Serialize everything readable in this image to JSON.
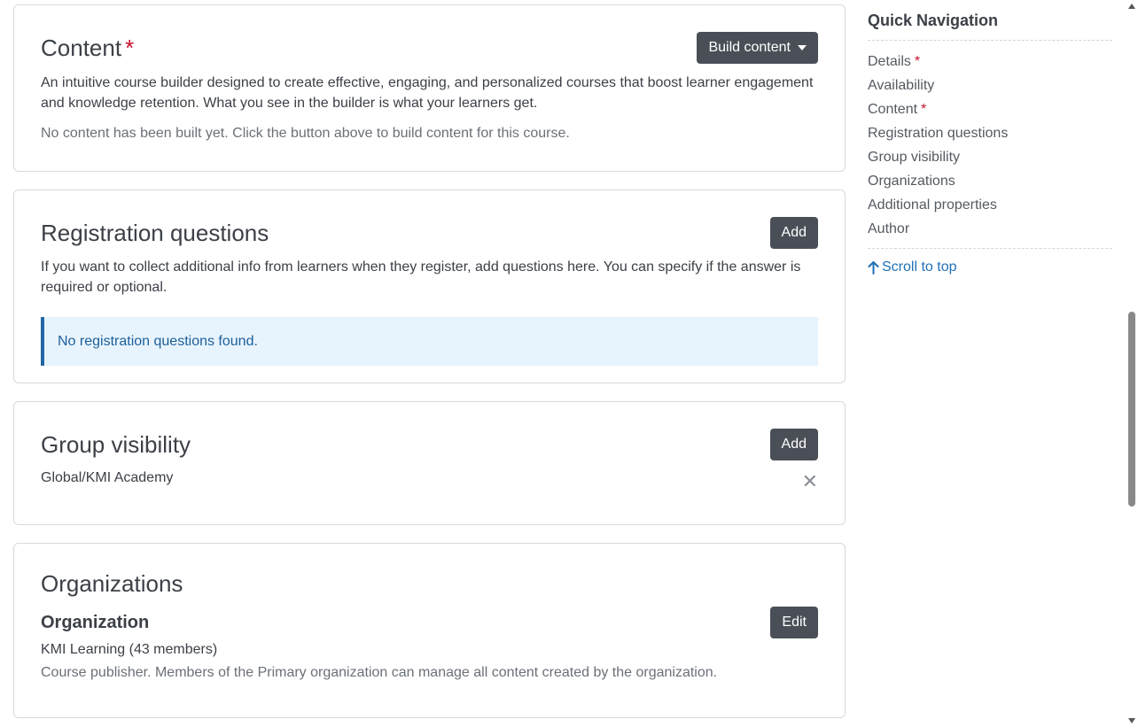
{
  "content": {
    "title": "Content",
    "required_mark": "*",
    "build_button": "Build content",
    "description": "An intuitive course builder designed to create effective, engaging, and personalized courses that boost learner engagement and knowledge retention. What you see in the builder is what your learners get.",
    "empty_text": "No content has been built yet. Click the button above to build content for this course."
  },
  "registration": {
    "title": "Registration questions",
    "add_button": "Add",
    "description": "If you want to collect additional info from learners when they register, add questions here. You can specify if the answer is required or optional.",
    "alert": "No registration questions found."
  },
  "visibility": {
    "title": "Group visibility",
    "add_button": "Add",
    "group": "Global/KMI Academy",
    "remove_glyph": "✕"
  },
  "organizations": {
    "title": "Organizations",
    "subtitle": "Organization",
    "edit_button": "Edit",
    "org_name": "KMI Learning (43 members)",
    "org_desc": "Course publisher. Members of the Primary organization can manage all content created by the organization."
  },
  "quick_nav": {
    "title": "Quick Navigation",
    "items": [
      {
        "label": "Details",
        "required": "*"
      },
      {
        "label": "Availability",
        "required": ""
      },
      {
        "label": "Content",
        "required": "*"
      },
      {
        "label": "Registration questions",
        "required": ""
      },
      {
        "label": "Group visibility",
        "required": ""
      },
      {
        "label": "Organizations",
        "required": ""
      },
      {
        "label": "Additional properties",
        "required": ""
      },
      {
        "label": "Author",
        "required": ""
      }
    ],
    "scroll_to_top": "Scroll to top"
  },
  "colors": {
    "button_bg": "#4a4f57",
    "required": "#c8102e",
    "link": "#1f6fb6",
    "alert_bg": "#e7f4fd",
    "alert_border": "#2367a5"
  }
}
